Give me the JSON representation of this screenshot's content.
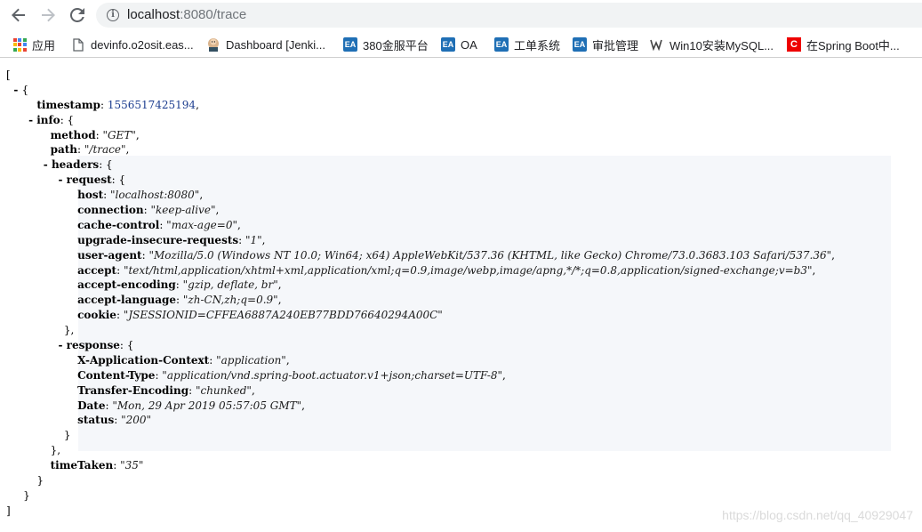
{
  "browser": {
    "url_host": "localhost",
    "url_rest": ":8080/trace"
  },
  "bookmarks": [
    {
      "label": "应用",
      "icon": "apps-grid-icon"
    },
    {
      "label": "devinfo.o2osit.eas...",
      "icon": "page-icon"
    },
    {
      "label": "Dashboard [Jenki...",
      "icon": "jenkins-icon"
    },
    {
      "label": "380金服平台",
      "icon": "ea-icon"
    },
    {
      "label": "OA",
      "icon": "ea-icon"
    },
    {
      "label": "工单系统",
      "icon": "ea-icon"
    },
    {
      "label": "审批管理",
      "icon": "ea-icon"
    },
    {
      "label": "Win10安装MySQL...",
      "icon": "w-icon"
    },
    {
      "label": "在Spring Boot中...",
      "icon": "csdn-icon"
    }
  ],
  "trace": {
    "timestamp": "1556517425194",
    "method": "\"GET\"",
    "path": "\"/trace\"",
    "request": {
      "host": "\"localhost:8080\"",
      "connection": "\"keep-alive\"",
      "cache_control": "\"max-age=0\"",
      "upgrade_insecure_requests": "\"1\"",
      "user_agent": "\"Mozilla/5.0 (Windows NT 10.0; Win64; x64) AppleWebKit/537.36 (KHTML, like Gecko) Chrome/73.0.3683.103 Safari/537.36\"",
      "accept": "\"text/html,application/xhtml+xml,application/xml;q=0.9,image/webp,image/apng,*/*;q=0.8,application/signed-exchange;v=b3\"",
      "accept_encoding": "\"gzip, deflate, br\"",
      "accept_language": "\"zh-CN,zh;q=0.9\"",
      "cookie": "\"JSESSIONID=CFFEA6887A240EB77BDD76640294A00C\""
    },
    "response": {
      "x_application_context": "\"application\"",
      "content_type": "\"application/vnd.spring-boot.actuator.v1+json;charset=UTF-8\"",
      "transfer_encoding": "\"chunked\"",
      "date": "\"Mon, 29 Apr 2019 05:57:05 GMT\"",
      "status": "\"200\""
    },
    "time_taken": "\"35\""
  },
  "keys": {
    "timestamp": "timestamp",
    "info": "info",
    "method": "method",
    "path": "path",
    "headers": "headers",
    "request": "request",
    "host": "host",
    "connection": "connection",
    "cache_control": "cache-control",
    "upgrade_insecure_requests": "upgrade-insecure-requests",
    "user_agent": "user-agent",
    "accept": "accept",
    "accept_encoding": "accept-encoding",
    "accept_language": "accept-language",
    "cookie": "cookie",
    "response": "response",
    "x_application_context": "X-Application-Context",
    "content_type": "Content-Type",
    "transfer_encoding": "Transfer-Encoding",
    "date": "Date",
    "status": "status",
    "time_taken": "timeTaken"
  },
  "watermark": "https://blog.csdn.net/qq_40929047"
}
